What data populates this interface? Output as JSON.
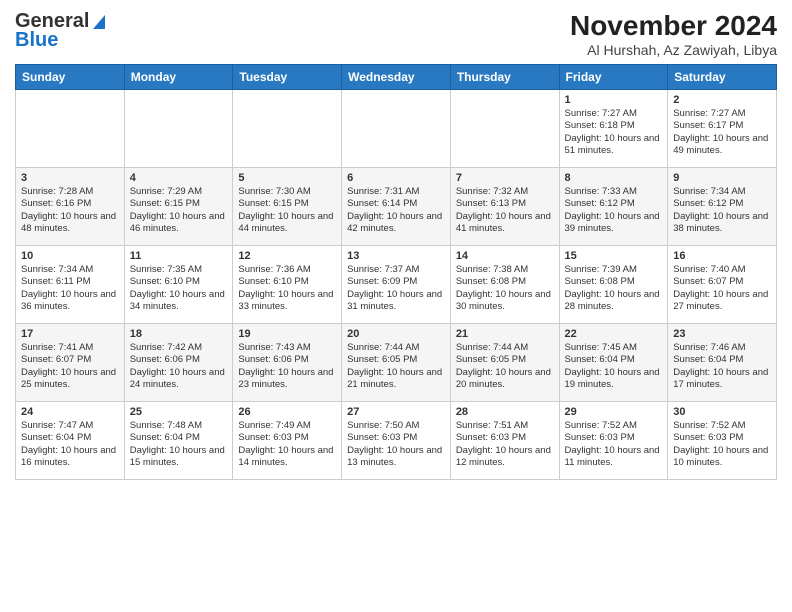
{
  "logo": {
    "general": "General",
    "blue": "Blue"
  },
  "title": "November 2024",
  "location": "Al Hurshah, Az Zawiyah, Libya",
  "days_header": [
    "Sunday",
    "Monday",
    "Tuesday",
    "Wednesday",
    "Thursday",
    "Friday",
    "Saturday"
  ],
  "weeks": [
    [
      {
        "day": "",
        "info": ""
      },
      {
        "day": "",
        "info": ""
      },
      {
        "day": "",
        "info": ""
      },
      {
        "day": "",
        "info": ""
      },
      {
        "day": "",
        "info": ""
      },
      {
        "day": "1",
        "info": "Sunrise: 7:27 AM\nSunset: 6:18 PM\nDaylight: 10 hours and 51 minutes."
      },
      {
        "day": "2",
        "info": "Sunrise: 7:27 AM\nSunset: 6:17 PM\nDaylight: 10 hours and 49 minutes."
      }
    ],
    [
      {
        "day": "3",
        "info": "Sunrise: 7:28 AM\nSunset: 6:16 PM\nDaylight: 10 hours and 48 minutes."
      },
      {
        "day": "4",
        "info": "Sunrise: 7:29 AM\nSunset: 6:15 PM\nDaylight: 10 hours and 46 minutes."
      },
      {
        "day": "5",
        "info": "Sunrise: 7:30 AM\nSunset: 6:15 PM\nDaylight: 10 hours and 44 minutes."
      },
      {
        "day": "6",
        "info": "Sunrise: 7:31 AM\nSunset: 6:14 PM\nDaylight: 10 hours and 42 minutes."
      },
      {
        "day": "7",
        "info": "Sunrise: 7:32 AM\nSunset: 6:13 PM\nDaylight: 10 hours and 41 minutes."
      },
      {
        "day": "8",
        "info": "Sunrise: 7:33 AM\nSunset: 6:12 PM\nDaylight: 10 hours and 39 minutes."
      },
      {
        "day": "9",
        "info": "Sunrise: 7:34 AM\nSunset: 6:12 PM\nDaylight: 10 hours and 38 minutes."
      }
    ],
    [
      {
        "day": "10",
        "info": "Sunrise: 7:34 AM\nSunset: 6:11 PM\nDaylight: 10 hours and 36 minutes."
      },
      {
        "day": "11",
        "info": "Sunrise: 7:35 AM\nSunset: 6:10 PM\nDaylight: 10 hours and 34 minutes."
      },
      {
        "day": "12",
        "info": "Sunrise: 7:36 AM\nSunset: 6:10 PM\nDaylight: 10 hours and 33 minutes."
      },
      {
        "day": "13",
        "info": "Sunrise: 7:37 AM\nSunset: 6:09 PM\nDaylight: 10 hours and 31 minutes."
      },
      {
        "day": "14",
        "info": "Sunrise: 7:38 AM\nSunset: 6:08 PM\nDaylight: 10 hours and 30 minutes."
      },
      {
        "day": "15",
        "info": "Sunrise: 7:39 AM\nSunset: 6:08 PM\nDaylight: 10 hours and 28 minutes."
      },
      {
        "day": "16",
        "info": "Sunrise: 7:40 AM\nSunset: 6:07 PM\nDaylight: 10 hours and 27 minutes."
      }
    ],
    [
      {
        "day": "17",
        "info": "Sunrise: 7:41 AM\nSunset: 6:07 PM\nDaylight: 10 hours and 25 minutes."
      },
      {
        "day": "18",
        "info": "Sunrise: 7:42 AM\nSunset: 6:06 PM\nDaylight: 10 hours and 24 minutes."
      },
      {
        "day": "19",
        "info": "Sunrise: 7:43 AM\nSunset: 6:06 PM\nDaylight: 10 hours and 23 minutes."
      },
      {
        "day": "20",
        "info": "Sunrise: 7:44 AM\nSunset: 6:05 PM\nDaylight: 10 hours and 21 minutes."
      },
      {
        "day": "21",
        "info": "Sunrise: 7:44 AM\nSunset: 6:05 PM\nDaylight: 10 hours and 20 minutes."
      },
      {
        "day": "22",
        "info": "Sunrise: 7:45 AM\nSunset: 6:04 PM\nDaylight: 10 hours and 19 minutes."
      },
      {
        "day": "23",
        "info": "Sunrise: 7:46 AM\nSunset: 6:04 PM\nDaylight: 10 hours and 17 minutes."
      }
    ],
    [
      {
        "day": "24",
        "info": "Sunrise: 7:47 AM\nSunset: 6:04 PM\nDaylight: 10 hours and 16 minutes."
      },
      {
        "day": "25",
        "info": "Sunrise: 7:48 AM\nSunset: 6:04 PM\nDaylight: 10 hours and 15 minutes."
      },
      {
        "day": "26",
        "info": "Sunrise: 7:49 AM\nSunset: 6:03 PM\nDaylight: 10 hours and 14 minutes."
      },
      {
        "day": "27",
        "info": "Sunrise: 7:50 AM\nSunset: 6:03 PM\nDaylight: 10 hours and 13 minutes."
      },
      {
        "day": "28",
        "info": "Sunrise: 7:51 AM\nSunset: 6:03 PM\nDaylight: 10 hours and 12 minutes."
      },
      {
        "day": "29",
        "info": "Sunrise: 7:52 AM\nSunset: 6:03 PM\nDaylight: 10 hours and 11 minutes."
      },
      {
        "day": "30",
        "info": "Sunrise: 7:52 AM\nSunset: 6:03 PM\nDaylight: 10 hours and 10 minutes."
      }
    ]
  ]
}
